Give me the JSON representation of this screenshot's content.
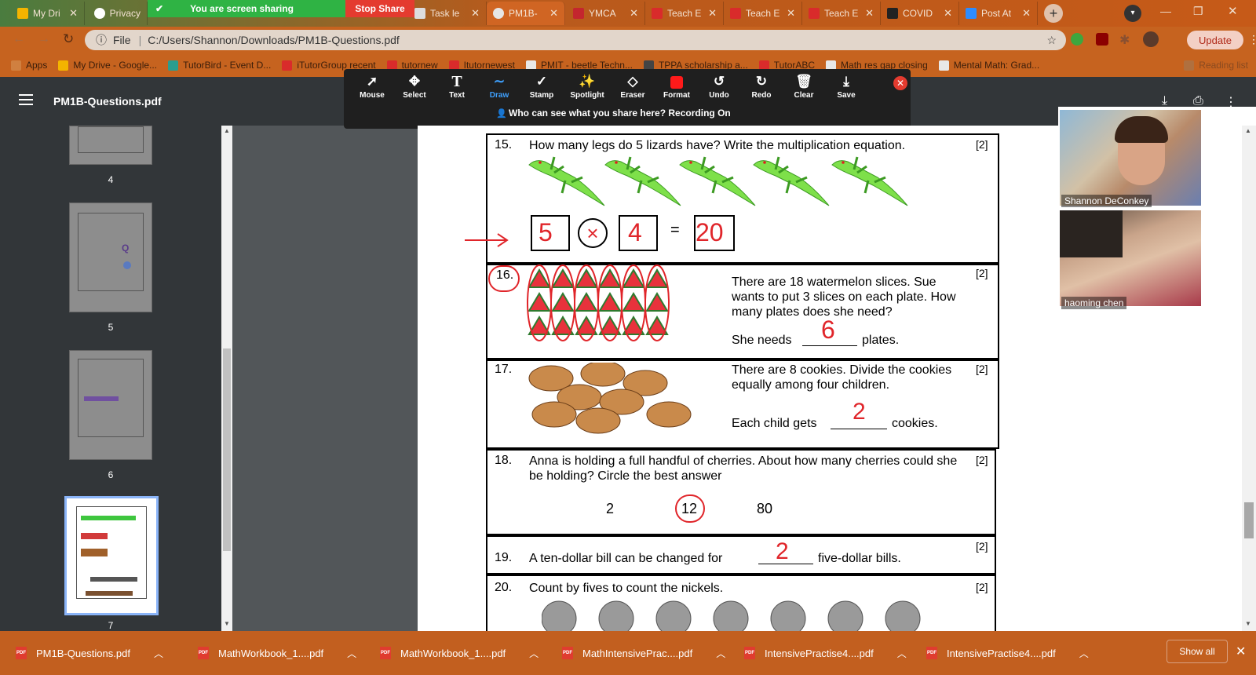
{
  "browser": {
    "tabs": [
      {
        "label": "My Dri",
        "icon": "google-drive-icon"
      },
      {
        "label": "Privacy",
        "icon": "google-icon"
      },
      {
        "label": "Task le",
        "icon": "document-icon"
      },
      {
        "label": "PM1B-",
        "icon": "globe-icon"
      },
      {
        "label": "YMCA",
        "icon": "ymca-icon"
      },
      {
        "label": "Teach E",
        "icon": "tutor-icon"
      },
      {
        "label": "Teach E",
        "icon": "tutor-icon"
      },
      {
        "label": "Teach E",
        "icon": "tutor-icon"
      },
      {
        "label": "COVID",
        "icon": "brave-icon"
      },
      {
        "label": "Post At",
        "icon": "zoom-icon"
      }
    ],
    "share_banner": "You are screen sharing",
    "stop_share": "Stop Share",
    "address": {
      "scheme": "File",
      "path": "C:/Users/Shannon/Downloads/PM1B-Questions.pdf"
    },
    "update_label": "Update",
    "bookmarks": [
      "Apps",
      "My Drive - Google...",
      "TutorBird - Event D...",
      "iTutorGroup recent",
      "tutornew",
      "Itutornewest",
      "PMIT - beetle Techn...",
      "TPPA scholarship a...",
      "TutorABC",
      "Math res gap closing",
      "Mental Math: Grad...",
      "Reading list"
    ]
  },
  "pdf": {
    "title": "PM1B-Questions.pdf",
    "thumbnails": [
      "4",
      "5",
      "6",
      "7"
    ]
  },
  "annotate": {
    "tools": [
      "Mouse",
      "Select",
      "Text",
      "Draw",
      "Stamp",
      "Spotlight",
      "Eraser",
      "Format",
      "Undo",
      "Redo",
      "Clear",
      "Save"
    ],
    "recording": "Who can see what you share here? Recording On"
  },
  "questions": {
    "q15": {
      "num": "15.",
      "text": "How many legs do 5 lizards have? Write the multiplication equation.",
      "pts": "[2]",
      "a": "5",
      "b": "4",
      "eq": "=",
      "result": "20"
    },
    "q16": {
      "num": "16.",
      "text": "There are 18 watermelon slices. Sue wants to put 3 slices on each plate. How many plates does she need?",
      "ans_pre": "She needs",
      "ans_post": "plates.",
      "answer": "6",
      "pts": "[2]"
    },
    "q17": {
      "num": "17.",
      "text": "There are 8 cookies. Divide the cookies equally among four children.",
      "ans_pre": "Each child gets",
      "ans_post": "cookies.",
      "answer": "2",
      "pts": "[2]"
    },
    "q18": {
      "num": "18.",
      "text": "Anna is holding a full handful of cherries. About how many cherries could she be holding? Circle the best answer",
      "options": [
        "2",
        "12",
        "80"
      ],
      "pts": "[2]"
    },
    "q19": {
      "num": "19.",
      "text_pre": "A ten-dollar bill can be changed for",
      "text_post": "five-dollar bills.",
      "answer": "2",
      "pts": "[2]"
    },
    "q20": {
      "num": "20.",
      "text": "Count by fives to count the nickels.",
      "pts": "[2]"
    }
  },
  "video": {
    "participants": [
      "Shannon DeConkey",
      "haoming   chen"
    ]
  },
  "downloads": {
    "items": [
      "PM1B-Questions.pdf",
      "MathWorkbook_1....pdf",
      "MathWorkbook_1....pdf",
      "MathIntensivePrac....pdf",
      "IntensivePractise4....pdf",
      "IntensivePractise4....pdf"
    ],
    "show_all": "Show all"
  }
}
